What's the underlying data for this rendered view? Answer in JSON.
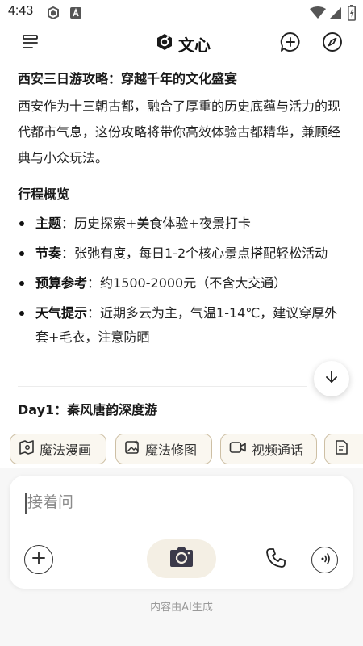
{
  "status_bar": {
    "time": "4:43"
  },
  "header": {
    "brand_name": "文心",
    "menu_icon": "menu-icon",
    "new_chat_icon": "new-chat-icon",
    "discover_icon": "compass-icon"
  },
  "article": {
    "title": "西安三日游攻略：穿越千年的文化盛宴",
    "intro": "西安作为十三朝古都，融合了厚重的历史底蕴与活力的现代都市气息，这份攻略将带你高效体验古都精华，兼顾经典与小众玩法。",
    "overview_heading": "行程概览",
    "bullets": [
      {
        "label": "主题",
        "text": "：历史探索+美食体验+夜景打卡"
      },
      {
        "label": "节奏",
        "text": "：张弛有度，每日1-2个核心景点搭配轻松活动"
      },
      {
        "label": "预算参考",
        "text": "：约1500-2000元（不含大交通）"
      },
      {
        "label": "天气提示",
        "text": "：近期多云为主，气温1-14℃，建议穿厚外套+毛衣，注意防晒"
      }
    ],
    "day1_heading": "Day1：秦风唐韵深度游"
  },
  "chips": [
    {
      "label": "魔法漫画",
      "icon": "comic-book-icon"
    },
    {
      "label": "魔法修图",
      "icon": "image-edit-icon"
    },
    {
      "label": "视频通话",
      "icon": "video-camera-icon"
    },
    {
      "label": "",
      "icon": "document-icon"
    }
  ],
  "composer": {
    "placeholder": "接着问",
    "footer_note": "内容由AI生成"
  },
  "colors": {
    "chip_border": "#cdbfa4",
    "chip_bg": "#faf7f0",
    "camera_bg": "#f4efe4",
    "camera_icon": "#3b3a4a"
  }
}
